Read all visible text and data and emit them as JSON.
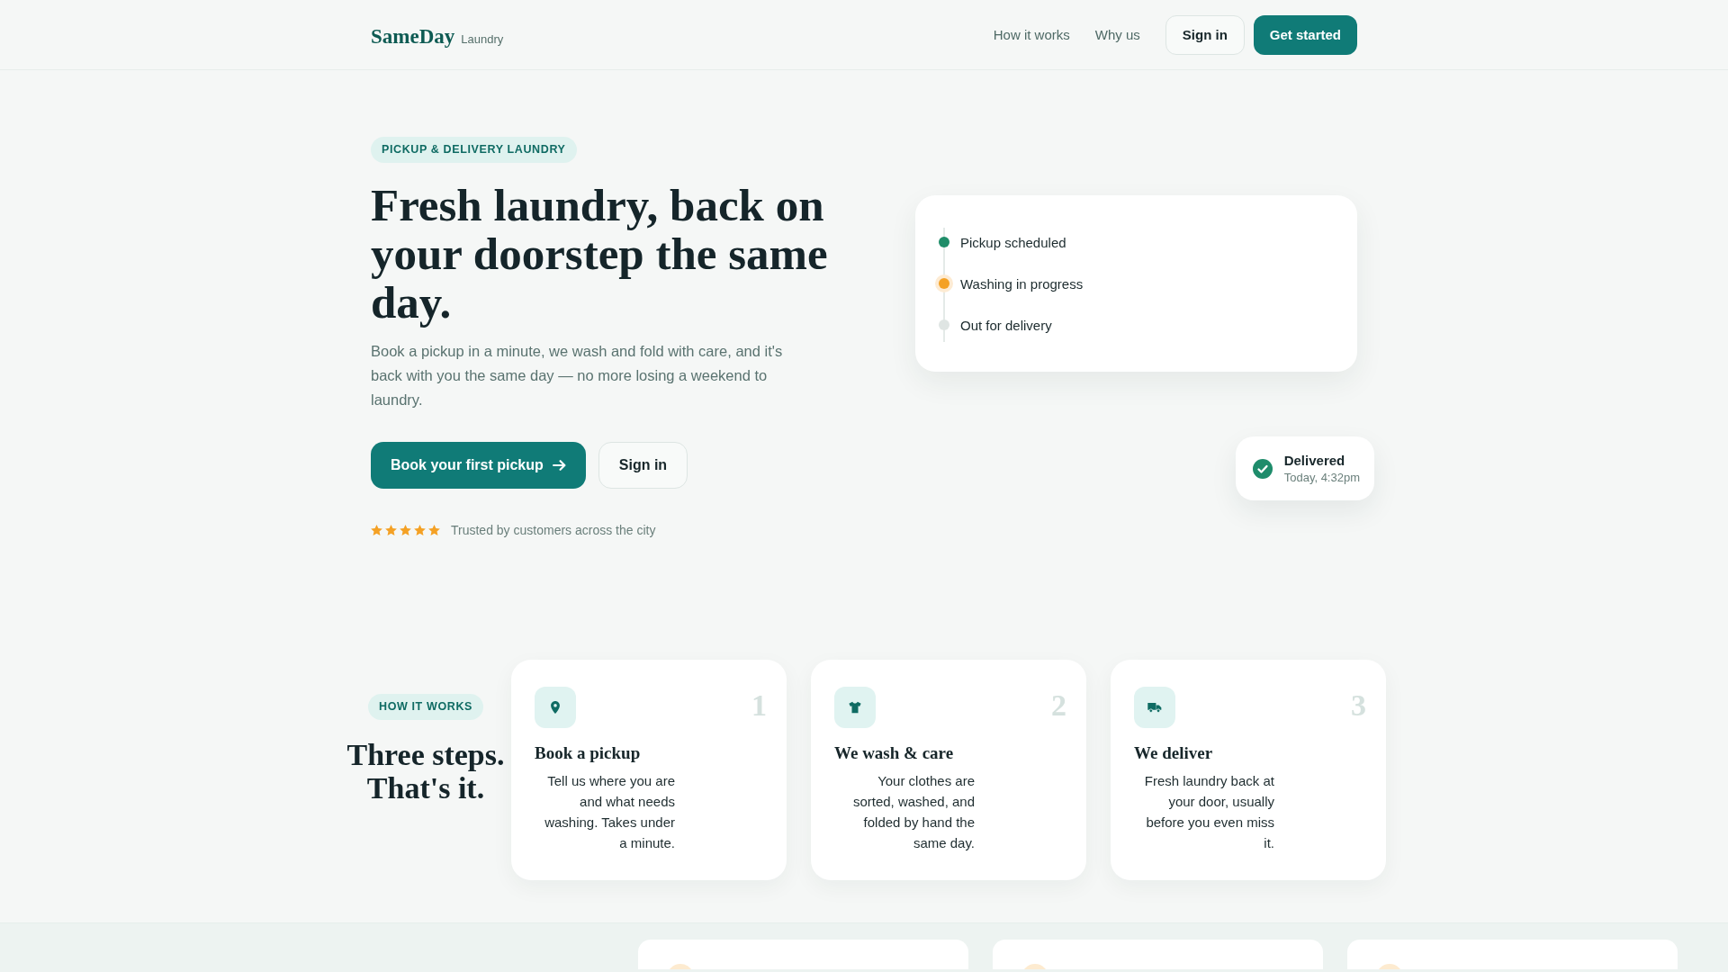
{
  "header": {
    "brand": {
      "name": "SameDay",
      "tagline": "Laundry"
    },
    "nav": [
      "How it works",
      "Why us"
    ],
    "sign_in_button": "Sign in",
    "get_started_button": "Get started"
  },
  "hero": {
    "badge": "PICKUP & DELIVERY LAUNDRY",
    "headline": "Fresh laundry, back on your doorstep the same day.",
    "description": "Book a pickup in a minute, we wash and fold with care, and it's back with you the same day — no more losing a weekend to laundry.",
    "primary_button": "Book your first pickup",
    "secondary_button": "Sign in",
    "rating": {
      "stars": 5,
      "text": "Trusted by customers across the city"
    }
  },
  "status_card": {
    "steps": [
      {
        "label": "Pickup scheduled",
        "completed": true,
        "current": false
      },
      {
        "label": "Washing in progress",
        "completed": false,
        "current": true
      },
      {
        "label": "Out for delivery",
        "completed": false,
        "current": false
      }
    ]
  },
  "delivery_toast": {
    "title": "Delivered",
    "time": "Today, 4:32pm"
  },
  "how_it_works": {
    "badge": "HOW IT WORKS",
    "heading": "Three steps. That's it.",
    "steps": [
      {
        "number": "1",
        "title": "Book a pickup",
        "description": "Tell us where you are and what needs washing. Takes under a minute."
      },
      {
        "number": "2",
        "title": "We wash & care",
        "description": "Your clothes are sorted, washed, and folded by hand the same day."
      },
      {
        "number": "3",
        "title": "We deliver",
        "description": "Fresh laundry back at your door, usually before you even miss it."
      }
    ]
  },
  "next_section": {
    "cards": [
      {
        "kind": "icon_card"
      },
      {
        "kind": "icon_card"
      },
      {
        "kind": "icon_card"
      }
    ]
  }
}
